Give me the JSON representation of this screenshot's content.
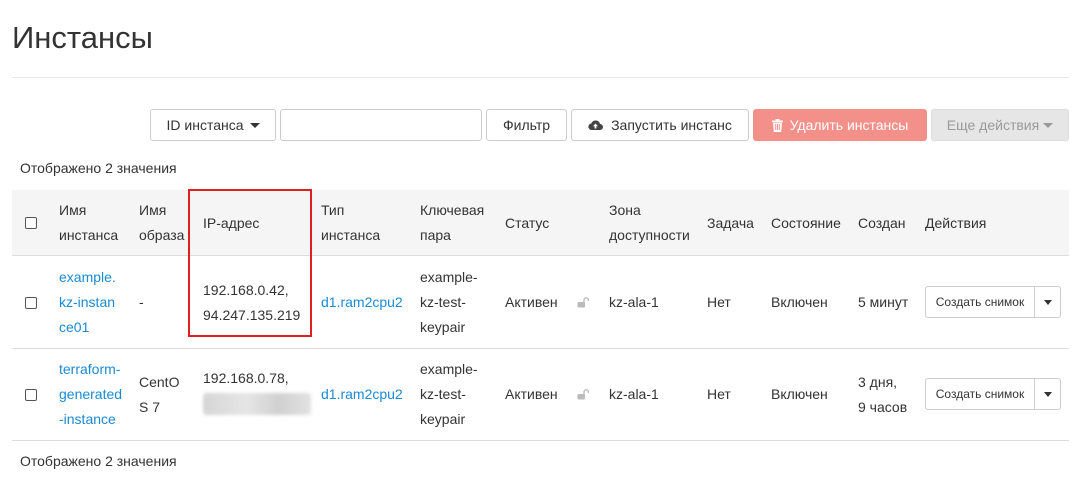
{
  "page": {
    "title": "Инстансы"
  },
  "toolbar": {
    "id_select_label": "ID инстанса",
    "filter_input_value": "",
    "filter_label": "Фильтр",
    "launch_label": "Запустить инстанс",
    "delete_label": "Удалить инстансы",
    "more_label": "Еще действия"
  },
  "summary": {
    "top": "Отображено 2 значения",
    "bottom": "Отображено 2 значения"
  },
  "table": {
    "headers": {
      "name": [
        "Имя",
        "инстанса"
      ],
      "image": [
        "Имя",
        "образа"
      ],
      "ip": [
        "IP-адрес"
      ],
      "flavor": [
        "Тип",
        "инстанса"
      ],
      "keypair": [
        "Ключевая",
        "пара"
      ],
      "status": [
        "Статус"
      ],
      "zone": [
        "Зона",
        "доступности"
      ],
      "task": [
        "Задача"
      ],
      "state": [
        "Состояние"
      ],
      "created": [
        "Создан"
      ],
      "actions": [
        "Действия"
      ]
    },
    "rows": [
      {
        "name": [
          "example.",
          "kz-instan",
          "ce01"
        ],
        "image": [
          "-"
        ],
        "ip": [
          "192.168.0.42,",
          "94.247.135.219"
        ],
        "ip_redacted": false,
        "flavor": "d1.ram2cpu2",
        "keypair": [
          "example-",
          "kz-test-",
          "keypair"
        ],
        "status": "Активен",
        "zone": "kz-ala-1",
        "task": "Нет",
        "state": "Включен",
        "created": [
          "5 минут"
        ],
        "action": "Создать снимок"
      },
      {
        "name": [
          "terraform-",
          "generated",
          "-instance"
        ],
        "image": [
          "CentO",
          "S 7"
        ],
        "ip": [
          "192.168.0.78,",
          ""
        ],
        "ip_redacted": true,
        "flavor": "d1.ram2cpu2",
        "keypair": [
          "example-",
          "kz-test-",
          "keypair"
        ],
        "status": "Активен",
        "zone": "kz-ala-1",
        "task": "Нет",
        "state": "Включен",
        "created": [
          "3 дня,",
          "9 часов"
        ],
        "action": "Создать снимок"
      }
    ]
  },
  "colors": {
    "link": "#1a8ad4",
    "danger": "#f4908a",
    "highlight": "#e02020"
  },
  "icons": {
    "launch": "cloud-upload-icon",
    "delete": "trash-icon",
    "lock": "unlock-icon"
  }
}
